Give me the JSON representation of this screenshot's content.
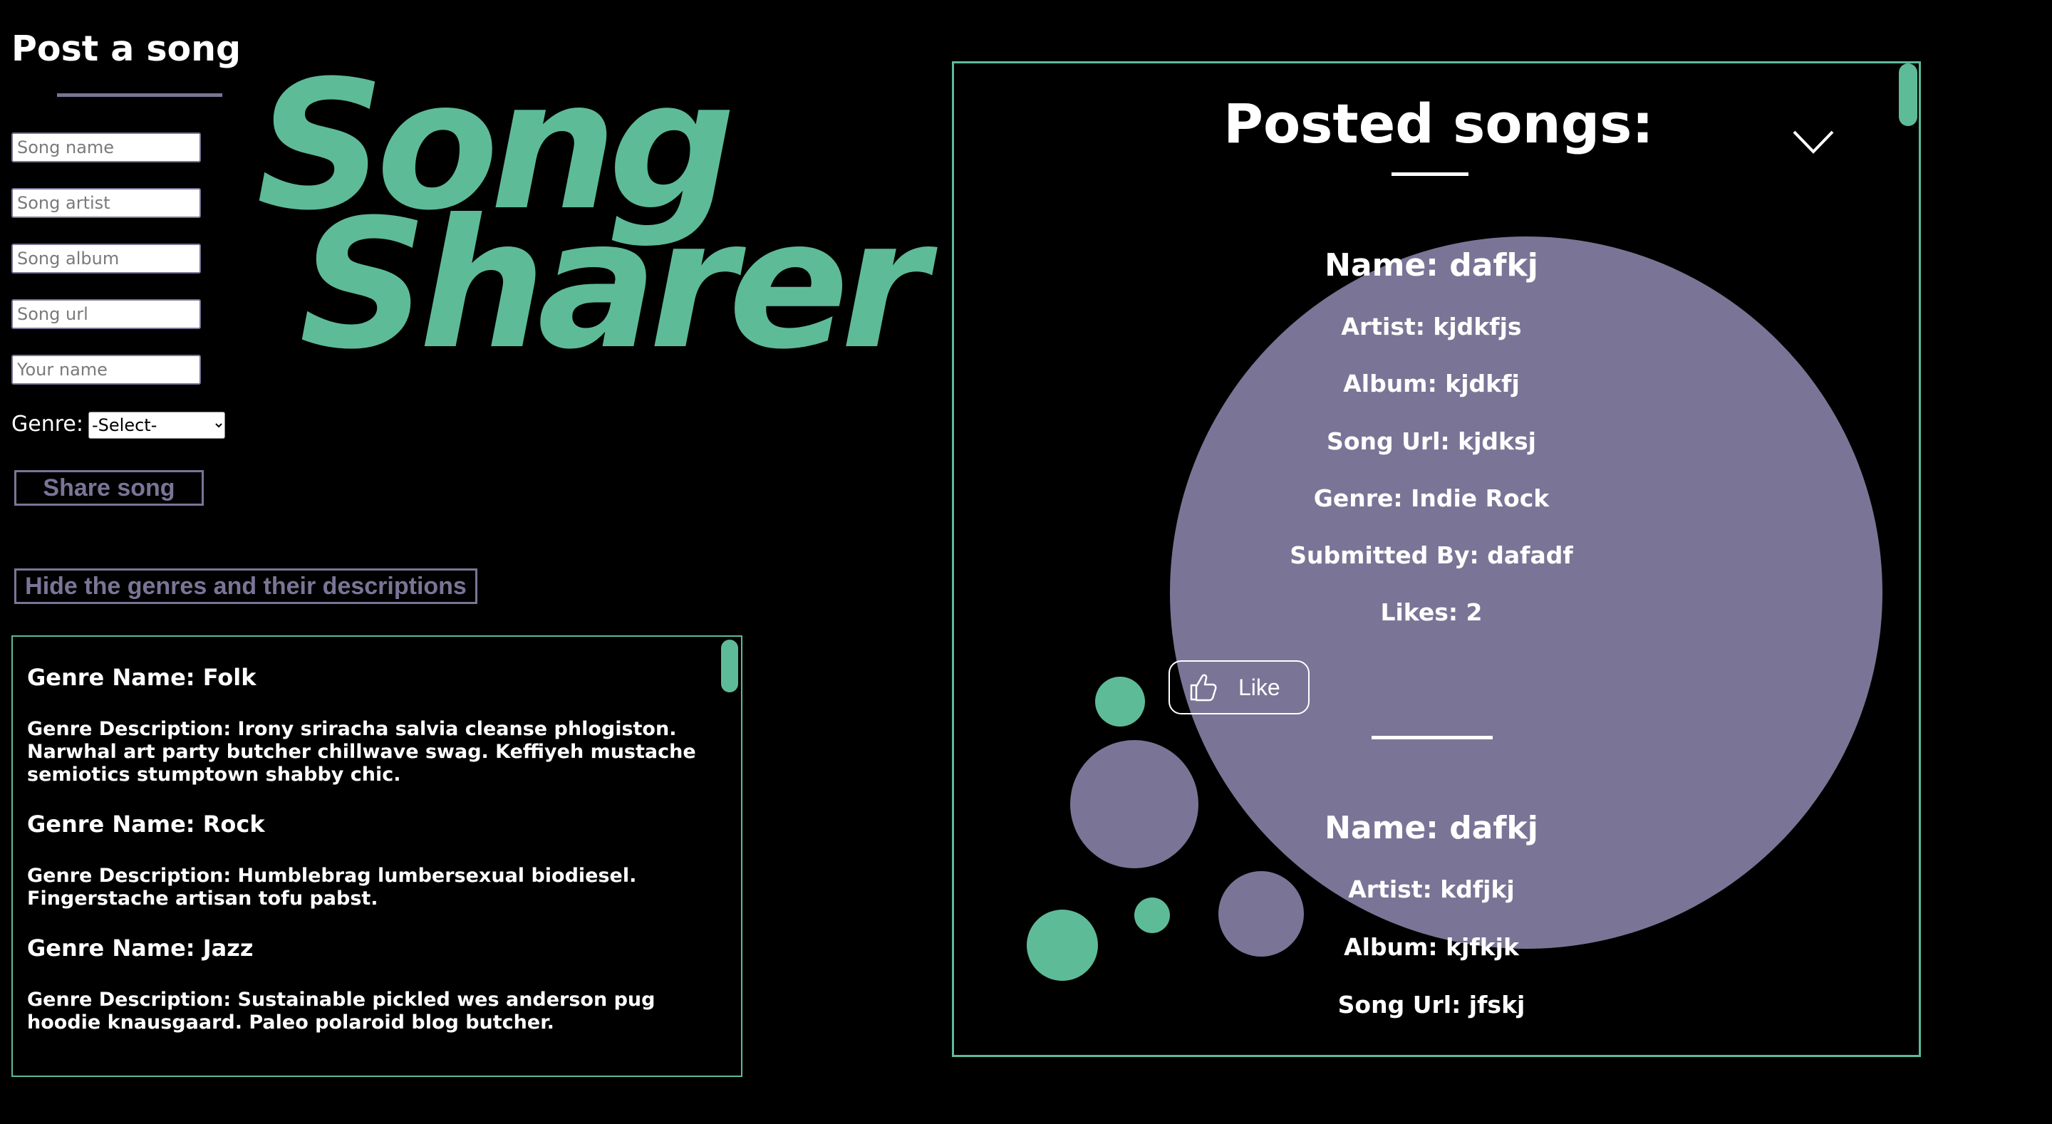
{
  "form": {
    "title": "Post a song",
    "song_name_placeholder": "Song name",
    "song_artist_placeholder": "Song artist",
    "song_album_placeholder": "Song album",
    "song_url_placeholder": "Song url",
    "your_name_placeholder": "Your name",
    "genre_label": "Genre:",
    "genre_selected": "-Select-",
    "share_label": "Share song",
    "hide_genres_label": "Hide the genres and their descriptions"
  },
  "genres": [
    {
      "name": "Genre Name: Folk",
      "description": "Genre Description: Irony sriracha salvia cleanse phlogiston. Narwhal art party butcher chillwave swag. Keffiyeh mustache semiotics stumptown shabby chic."
    },
    {
      "name": "Genre Name: Rock",
      "description": "Genre Description: Humblebrag lumbersexual biodiesel. Fingerstache artisan tofu pabst."
    },
    {
      "name": "Genre Name: Jazz",
      "description": "Genre Description: Sustainable pickled wes anderson pug hoodie knausgaard. Paleo polaroid blog butcher."
    }
  ],
  "brand": {
    "line1": "Song",
    "line2": "Sharer"
  },
  "posted": {
    "title": "Posted songs:",
    "chevron_icon": "chevron-down-icon",
    "songs": [
      {
        "name": "Name: dafkj",
        "artist": "Artist: kjdkfjs",
        "album": "Album: kjdkfj",
        "url": "Song Url: kjdksj",
        "genre": "Genre: Indie Rock",
        "submitted": "Submitted By: dafadf",
        "likes": "Likes: 2",
        "like_label": "Like"
      },
      {
        "name": "Name: dafkj",
        "artist": "Artist: kdfjkj",
        "album": "Album: kjfkjk",
        "url": "Song Url: jfskj"
      }
    ]
  },
  "colors": {
    "accent_green": "#5ebb97",
    "accent_purple": "#7a7596",
    "background": "#000000",
    "text": "#ffffff"
  }
}
